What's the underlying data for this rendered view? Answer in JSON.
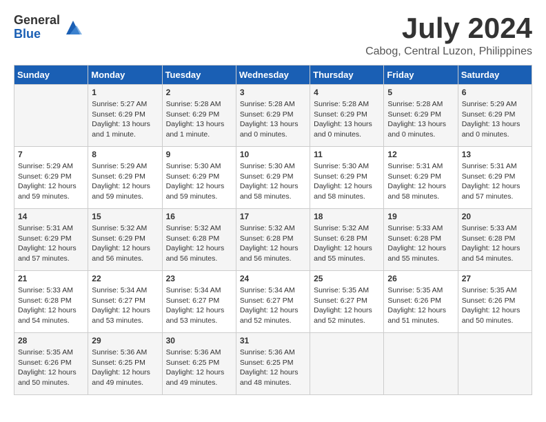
{
  "logo": {
    "general": "General",
    "blue": "Blue"
  },
  "title": "July 2024",
  "location": "Cabog, Central Luzon, Philippines",
  "days_header": [
    "Sunday",
    "Monday",
    "Tuesday",
    "Wednesday",
    "Thursday",
    "Friday",
    "Saturday"
  ],
  "weeks": [
    [
      {
        "day": "",
        "info": ""
      },
      {
        "day": "1",
        "info": "Sunrise: 5:27 AM\nSunset: 6:29 PM\nDaylight: 13 hours\nand 1 minute."
      },
      {
        "day": "2",
        "info": "Sunrise: 5:28 AM\nSunset: 6:29 PM\nDaylight: 13 hours\nand 1 minute."
      },
      {
        "day": "3",
        "info": "Sunrise: 5:28 AM\nSunset: 6:29 PM\nDaylight: 13 hours\nand 0 minutes."
      },
      {
        "day": "4",
        "info": "Sunrise: 5:28 AM\nSunset: 6:29 PM\nDaylight: 13 hours\nand 0 minutes."
      },
      {
        "day": "5",
        "info": "Sunrise: 5:28 AM\nSunset: 6:29 PM\nDaylight: 13 hours\nand 0 minutes."
      },
      {
        "day": "6",
        "info": "Sunrise: 5:29 AM\nSunset: 6:29 PM\nDaylight: 13 hours\nand 0 minutes."
      }
    ],
    [
      {
        "day": "7",
        "info": "Sunrise: 5:29 AM\nSunset: 6:29 PM\nDaylight: 12 hours\nand 59 minutes."
      },
      {
        "day": "8",
        "info": "Sunrise: 5:29 AM\nSunset: 6:29 PM\nDaylight: 12 hours\nand 59 minutes."
      },
      {
        "day": "9",
        "info": "Sunrise: 5:30 AM\nSunset: 6:29 PM\nDaylight: 12 hours\nand 59 minutes."
      },
      {
        "day": "10",
        "info": "Sunrise: 5:30 AM\nSunset: 6:29 PM\nDaylight: 12 hours\nand 58 minutes."
      },
      {
        "day": "11",
        "info": "Sunrise: 5:30 AM\nSunset: 6:29 PM\nDaylight: 12 hours\nand 58 minutes."
      },
      {
        "day": "12",
        "info": "Sunrise: 5:31 AM\nSunset: 6:29 PM\nDaylight: 12 hours\nand 58 minutes."
      },
      {
        "day": "13",
        "info": "Sunrise: 5:31 AM\nSunset: 6:29 PM\nDaylight: 12 hours\nand 57 minutes."
      }
    ],
    [
      {
        "day": "14",
        "info": "Sunrise: 5:31 AM\nSunset: 6:29 PM\nDaylight: 12 hours\nand 57 minutes."
      },
      {
        "day": "15",
        "info": "Sunrise: 5:32 AM\nSunset: 6:29 PM\nDaylight: 12 hours\nand 56 minutes."
      },
      {
        "day": "16",
        "info": "Sunrise: 5:32 AM\nSunset: 6:28 PM\nDaylight: 12 hours\nand 56 minutes."
      },
      {
        "day": "17",
        "info": "Sunrise: 5:32 AM\nSunset: 6:28 PM\nDaylight: 12 hours\nand 56 minutes."
      },
      {
        "day": "18",
        "info": "Sunrise: 5:32 AM\nSunset: 6:28 PM\nDaylight: 12 hours\nand 55 minutes."
      },
      {
        "day": "19",
        "info": "Sunrise: 5:33 AM\nSunset: 6:28 PM\nDaylight: 12 hours\nand 55 minutes."
      },
      {
        "day": "20",
        "info": "Sunrise: 5:33 AM\nSunset: 6:28 PM\nDaylight: 12 hours\nand 54 minutes."
      }
    ],
    [
      {
        "day": "21",
        "info": "Sunrise: 5:33 AM\nSunset: 6:28 PM\nDaylight: 12 hours\nand 54 minutes."
      },
      {
        "day": "22",
        "info": "Sunrise: 5:34 AM\nSunset: 6:27 PM\nDaylight: 12 hours\nand 53 minutes."
      },
      {
        "day": "23",
        "info": "Sunrise: 5:34 AM\nSunset: 6:27 PM\nDaylight: 12 hours\nand 53 minutes."
      },
      {
        "day": "24",
        "info": "Sunrise: 5:34 AM\nSunset: 6:27 PM\nDaylight: 12 hours\nand 52 minutes."
      },
      {
        "day": "25",
        "info": "Sunrise: 5:35 AM\nSunset: 6:27 PM\nDaylight: 12 hours\nand 52 minutes."
      },
      {
        "day": "26",
        "info": "Sunrise: 5:35 AM\nSunset: 6:26 PM\nDaylight: 12 hours\nand 51 minutes."
      },
      {
        "day": "27",
        "info": "Sunrise: 5:35 AM\nSunset: 6:26 PM\nDaylight: 12 hours\nand 50 minutes."
      }
    ],
    [
      {
        "day": "28",
        "info": "Sunrise: 5:35 AM\nSunset: 6:26 PM\nDaylight: 12 hours\nand 50 minutes."
      },
      {
        "day": "29",
        "info": "Sunrise: 5:36 AM\nSunset: 6:25 PM\nDaylight: 12 hours\nand 49 minutes."
      },
      {
        "day": "30",
        "info": "Sunrise: 5:36 AM\nSunset: 6:25 PM\nDaylight: 12 hours\nand 49 minutes."
      },
      {
        "day": "31",
        "info": "Sunrise: 5:36 AM\nSunset: 6:25 PM\nDaylight: 12 hours\nand 48 minutes."
      },
      {
        "day": "",
        "info": ""
      },
      {
        "day": "",
        "info": ""
      },
      {
        "day": "",
        "info": ""
      }
    ]
  ]
}
